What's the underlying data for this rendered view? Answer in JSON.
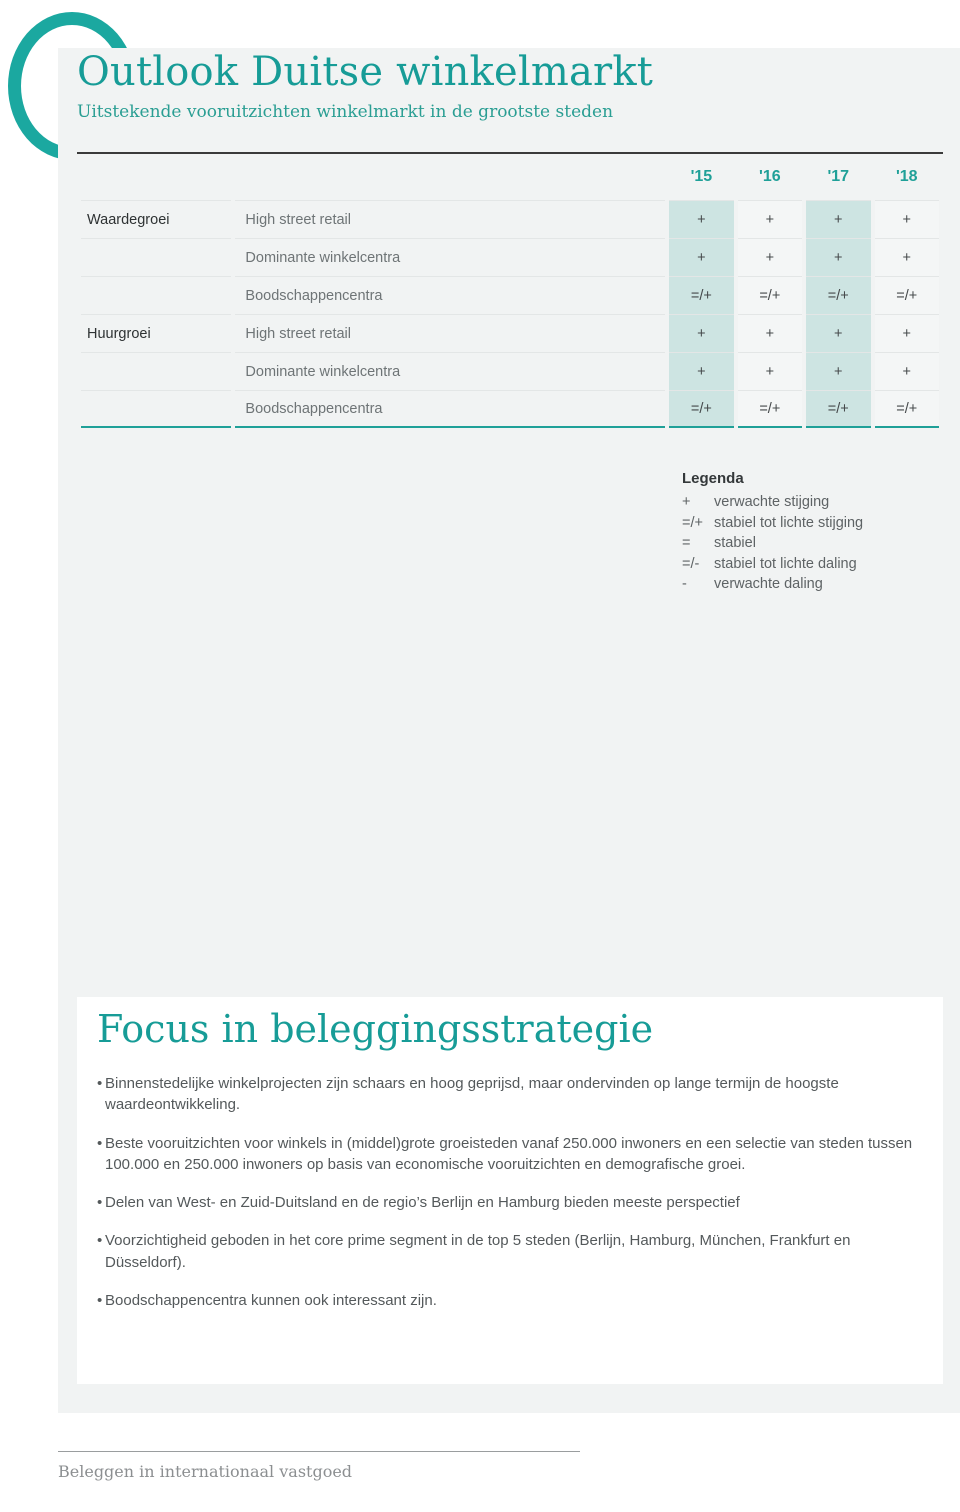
{
  "header": {
    "title": "Outlook Duitse winkelmarkt",
    "subtitle": "Uitstekende vooruitzichten winkelmarkt in de grootste steden",
    "accent_color": "#179c97",
    "panel_color": "#f1f3f3"
  },
  "table": {
    "year_columns": [
      "'15",
      "'16",
      "'17",
      "'18"
    ],
    "highlighted_columns": [
      "'15",
      "'17"
    ],
    "highlight_color": "#cde4e2",
    "rows": [
      {
        "group": "Waardegroei",
        "item": "High street retail",
        "values": [
          "+",
          "+",
          "+",
          "+"
        ]
      },
      {
        "group": "",
        "item": "Dominante winkelcentra",
        "values": [
          "+",
          "+",
          "+",
          "+"
        ]
      },
      {
        "group": "",
        "item": "Boodschappencentra",
        "values": [
          "=/+",
          "=/+",
          "=/+",
          "=/+"
        ]
      },
      {
        "group": "Huurgroei",
        "item": "High street retail",
        "values": [
          "+",
          "+",
          "+",
          "+"
        ]
      },
      {
        "group": "",
        "item": "Dominante winkelcentra",
        "values": [
          "+",
          "+",
          "+",
          "+"
        ]
      },
      {
        "group": "",
        "item": "Boodschappencentra",
        "values": [
          "=/+",
          "=/+",
          "=/+",
          "=/+"
        ]
      }
    ]
  },
  "legend": {
    "title": "Legenda",
    "entries": [
      {
        "symbol": "+",
        "label": "verwachte stijging"
      },
      {
        "symbol": "=/+",
        "label": "stabiel tot lichte stijging"
      },
      {
        "symbol": "=",
        "label": "stabiel"
      },
      {
        "symbol": "=/-",
        "label": "stabiel tot lichte daling"
      },
      {
        "symbol": "-",
        "label": "verwachte daling"
      }
    ]
  },
  "focus": {
    "title": "Focus in beleggingsstrategie",
    "bullets": [
      "Binnenstedelijke winkelprojecten zijn schaars en hoog geprijsd, maar ondervinden op lange termijn de hoogste waardeontwikkeling.",
      "Beste vooruitzichten voor winkels in (middel)grote groeisteden vanaf 250.000 inwoners en een selectie van steden tussen 100.000 en 250.000 inwoners op basis van economische vooruitzichten en demografische groei.",
      "Delen van West- en Zuid-Duitsland en de regio’s Berlijn en Hamburg bieden meeste perspectief",
      "Voorzichtigheid geboden in het core prime segment in de top 5 steden (Berlijn, Hamburg, München, Frankfurt en Düsseldorf).",
      "Boodschappencentra kunnen ook interessant zijn."
    ],
    "bullet_marker": "•"
  },
  "footer": {
    "text": "Beleggen in internationaal vastgoed"
  }
}
